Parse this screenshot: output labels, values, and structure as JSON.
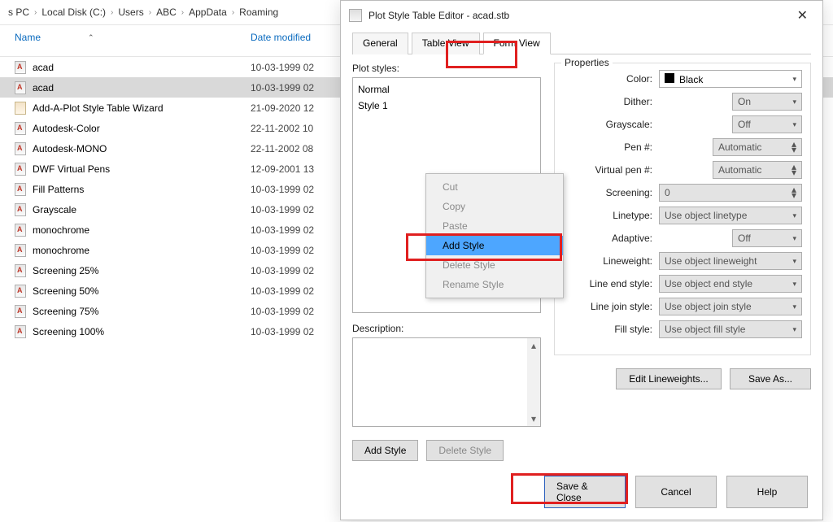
{
  "breadcrumb": [
    "s PC",
    "Local Disk (C:)",
    "Users",
    "ABC",
    "AppData",
    "Roaming"
  ],
  "columns": {
    "name": "Name",
    "date": "Date modified"
  },
  "files": [
    {
      "icon": "stb",
      "name": "acad",
      "date": "10-03-1999 02"
    },
    {
      "icon": "stb",
      "name": "acad",
      "date": "10-03-1999 02",
      "selected": true
    },
    {
      "icon": "wiz",
      "name": "Add-A-Plot Style Table Wizard",
      "date": "21-09-2020 12"
    },
    {
      "icon": "stb",
      "name": "Autodesk-Color",
      "date": "22-11-2002 10"
    },
    {
      "icon": "stb",
      "name": "Autodesk-MONO",
      "date": "22-11-2002 08"
    },
    {
      "icon": "stb",
      "name": "DWF Virtual Pens",
      "date": "12-09-2001 13"
    },
    {
      "icon": "stb",
      "name": "Fill Patterns",
      "date": "10-03-1999 02"
    },
    {
      "icon": "stb",
      "name": "Grayscale",
      "date": "10-03-1999 02"
    },
    {
      "icon": "stb",
      "name": "monochrome",
      "date": "10-03-1999 02"
    },
    {
      "icon": "stb",
      "name": "monochrome",
      "date": "10-03-1999 02"
    },
    {
      "icon": "stb",
      "name": "Screening 25%",
      "date": "10-03-1999 02"
    },
    {
      "icon": "stb",
      "name": "Screening 50%",
      "date": "10-03-1999 02"
    },
    {
      "icon": "stb",
      "name": "Screening 75%",
      "date": "10-03-1999 02"
    },
    {
      "icon": "stb",
      "name": "Screening 100%",
      "date": "10-03-1999 02"
    }
  ],
  "dialog": {
    "title": "Plot Style Table Editor - acad.stb",
    "tabs": [
      "General",
      "Table View",
      "Form View"
    ],
    "plot_styles_label": "Plot styles:",
    "plot_styles": [
      "Normal",
      "Style 1"
    ],
    "description_label": "Description:",
    "add_style_btn": "Add Style",
    "delete_style_btn": "Delete Style",
    "edit_lw_btn": "Edit Lineweights...",
    "save_as_btn": "Save As...",
    "save_close_btn": "Save & Close",
    "cancel_btn": "Cancel",
    "help_btn": "Help",
    "properties": {
      "legend": "Properties",
      "color_label": "Color:",
      "color_value": "Black",
      "dither_label": "Dither:",
      "dither_value": "On",
      "gray_label": "Grayscale:",
      "gray_value": "Off",
      "pen_label": "Pen #:",
      "pen_value": "Automatic",
      "vpen_label": "Virtual pen #:",
      "vpen_value": "Automatic",
      "screening_label": "Screening:",
      "screening_value": "0",
      "linetype_label": "Linetype:",
      "linetype_value": "Use object linetype",
      "adaptive_label": "Adaptive:",
      "adaptive_value": "Off",
      "lineweight_label": "Lineweight:",
      "lineweight_value": "Use object lineweight",
      "endstyle_label": "Line end style:",
      "endstyle_value": "Use object end style",
      "joinstyle_label": "Line join style:",
      "joinstyle_value": "Use object join style",
      "fillstyle_label": "Fill style:",
      "fillstyle_value": "Use object fill style"
    }
  },
  "context_menu": {
    "items": [
      {
        "label": "Cut",
        "enabled": false
      },
      {
        "label": "Copy",
        "enabled": false
      },
      {
        "label": "Paste",
        "enabled": false
      },
      {
        "label": "Add Style",
        "enabled": true,
        "highlight": true
      },
      {
        "label": "Delete Style",
        "enabled": false
      },
      {
        "label": "Rename Style",
        "enabled": false
      }
    ]
  }
}
